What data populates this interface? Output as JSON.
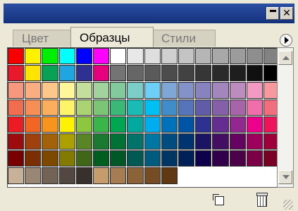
{
  "window": {
    "minimize_icon": "minimize-icon",
    "close_label": "✕"
  },
  "tabs": [
    {
      "label": "Цвет",
      "active": false
    },
    {
      "label": "Образцы",
      "active": true
    },
    {
      "label": "Стили",
      "active": false
    }
  ],
  "swatches": {
    "rows": [
      [
        "#f80000",
        "#fff200",
        "#00ee00",
        "#00ffff",
        "#0000ff",
        "#ff00ff",
        "#ffffff",
        "#e8e8e8",
        "#dedede",
        "#d0d0d0",
        "#c4c4c4",
        "#b6b6b6",
        "#a8a8a8",
        "#9c9c9c",
        "#8e8e8e",
        "#828282"
      ],
      [
        "#e8192c",
        "#ffe400",
        "#09a154",
        "#1ea6e0",
        "#2e3092",
        "#e6007e",
        "#747474",
        "#666666",
        "#5a5a5a",
        "#4c4c4c",
        "#424242",
        "#363636",
        "#2a2a2a",
        "#1e1e1e",
        "#101010",
        "#000000"
      ],
      [
        "#f6977e",
        "#f9ad81",
        "#fdc68a",
        "#fff799",
        "#c4df9b",
        "#a3d39c",
        "#82ca9c",
        "#7bcdc8",
        "#6ecff6",
        "#7ea7d8",
        "#8393ca",
        "#8882be",
        "#a286bd",
        "#bd8cbf",
        "#f49ac2",
        "#f6989d"
      ],
      [
        "#f26c4f",
        "#f68e56",
        "#fbaf5d",
        "#fff467",
        "#acd373",
        "#7cc576",
        "#3bb878",
        "#1abbb4",
        "#00bff3",
        "#438cca",
        "#5574b9",
        "#605ca8",
        "#8560a8",
        "#a864a8",
        "#f06ea9",
        "#f26d7d"
      ],
      [
        "#ed1c24",
        "#f26522",
        "#f7941d",
        "#fff200",
        "#8dc63f",
        "#39b54a",
        "#00a651",
        "#00a99d",
        "#00aeef",
        "#0072bc",
        "#0054a6",
        "#2e3192",
        "#662d91",
        "#92278f",
        "#ec008c",
        "#ed145b"
      ],
      [
        "#9e0b0f",
        "#a0410d",
        "#a36209",
        "#aba000",
        "#598527",
        "#1a7b30",
        "#007236",
        "#00746b",
        "#0076a3",
        "#004b80",
        "#003471",
        "#1b1464",
        "#440e62",
        "#630460",
        "#9e005d",
        "#9e0039"
      ],
      [
        "#790000",
        "#7b2e00",
        "#7d4900",
        "#827b00",
        "#406618",
        "#005e20",
        "#005826",
        "#005952",
        "#005b7f",
        "#003663",
        "#002157",
        "#0d004c",
        "#32004b",
        "#4b0049",
        "#7b0046",
        "#7a0026"
      ],
      [
        "#c7b299",
        "#998675",
        "#736357",
        "#534741",
        "#37302d",
        "#c69c6d",
        "#a67c52",
        "#8c6239",
        "#754c24",
        "#603913"
      ]
    ]
  },
  "scrollbar": {
    "up_icon": "scroll-up-arrow-icon",
    "down_icon": "scroll-down-arrow-icon"
  },
  "bottom_bar": {
    "new_icon": "new-swatch-icon",
    "trash_icon": "trash-icon"
  }
}
